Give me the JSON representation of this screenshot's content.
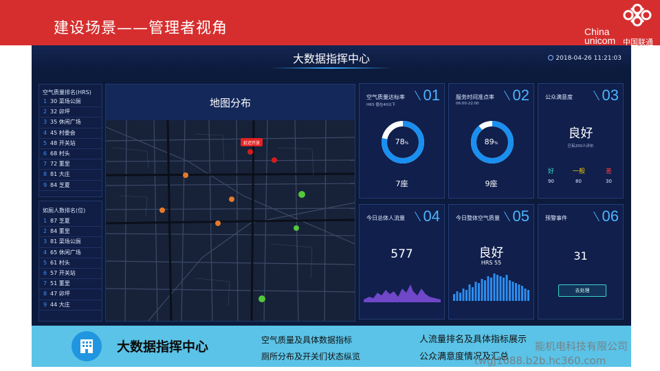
{
  "slide": {
    "title": "建设场景——管理者视角",
    "logo_en_1": "China",
    "logo_en_2": "unicom",
    "logo_cn": "中国联通",
    "brand_color": "#d62e2e"
  },
  "dashboard": {
    "title": "大数据指挥中心",
    "datetime": "2018-04-26 11:21:03",
    "air_rank": {
      "title": "空气质量排名(HRS)",
      "items": [
        {
          "n": "1",
          "value": "30",
          "name": "菜场公厕"
        },
        {
          "n": "2",
          "value": "32",
          "name": "卯坪"
        },
        {
          "n": "3",
          "value": "35",
          "name": "休闲广场"
        },
        {
          "n": "4",
          "value": "45",
          "name": "村委会"
        },
        {
          "n": "5",
          "value": "48",
          "name": "开关站"
        },
        {
          "n": "6",
          "value": "68",
          "name": "村头"
        },
        {
          "n": "7",
          "value": "72",
          "name": "董里"
        },
        {
          "n": "8",
          "value": "81",
          "name": "大庄"
        },
        {
          "n": "9",
          "value": "84",
          "name": "芝夏"
        }
      ]
    },
    "people_rank": {
      "title": "如厕人数排名(位)",
      "items": [
        {
          "n": "1",
          "value": "87",
          "name": "芝夏"
        },
        {
          "n": "2",
          "value": "84",
          "name": "董里"
        },
        {
          "n": "3",
          "value": "81",
          "name": "菜场公厕"
        },
        {
          "n": "4",
          "value": "65",
          "name": "休闲广场"
        },
        {
          "n": "5",
          "value": "61",
          "name": "村头"
        },
        {
          "n": "6",
          "value": "57",
          "name": "开关站"
        },
        {
          "n": "7",
          "value": "51",
          "name": "董里"
        },
        {
          "n": "8",
          "value": "47",
          "name": "卯坪"
        },
        {
          "n": "9",
          "value": "44",
          "name": "大庄"
        }
      ]
    },
    "map": {
      "title": "地图分布",
      "popup": "延迟开放"
    },
    "cards": {
      "c01": {
        "num": "01",
        "label": "空气质量达标率",
        "sub": "HRS 值在40以下",
        "percent": 78,
        "percent_text": "78",
        "unit": "%",
        "count": "7座"
      },
      "c02": {
        "num": "02",
        "label": "服务时间准点率",
        "sub": "06:00-22:00",
        "percent": 89,
        "percent_text": "89",
        "unit": "%",
        "count": "9座"
      },
      "c03": {
        "num": "03",
        "label": "公众满意度",
        "value": "良好",
        "sub": "已有200人评价",
        "good_label": "好",
        "mid_label": "一般",
        "bad_label": "差",
        "good_val": "90",
        "mid_val": "80",
        "bad_val": "30"
      },
      "c04": {
        "num": "04",
        "label": "今日总体人流量",
        "value": "577"
      },
      "c05": {
        "num": "05",
        "label": "今日整体空气质量",
        "value": "良好",
        "sub": "HRS 55"
      },
      "c06": {
        "num": "06",
        "label": "预警事件",
        "value": "31",
        "button": "去处理"
      }
    }
  },
  "banner": {
    "title": "大数据指挥中心",
    "t1": "空气质量及具体数据指标",
    "t2": "厕所分布及开关们状态纵览",
    "t3": "人流量排名及具体指标展示",
    "t4": "公众满意度情况及汇总"
  },
  "watermark": {
    "line1": "能机电科技有限公司",
    "line2": "twgj1688.b2b.hc360.com"
  },
  "colors": {
    "accent": "#4db5ff",
    "good": "#3bd6c8",
    "mid": "#f2c400",
    "bad": "#ff3d3d"
  }
}
